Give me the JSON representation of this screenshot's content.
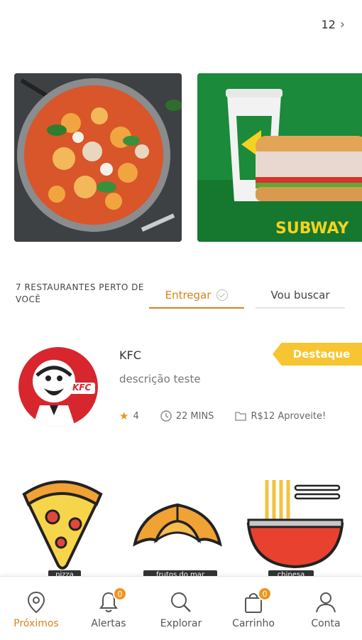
{
  "header": {
    "count": "12"
  },
  "banners": [
    {
      "name": "pasta-banner"
    },
    {
      "name": "subway-banner",
      "brand": "SUBWAY"
    }
  ],
  "section": {
    "nearby_text": "7 RESTAURANTES PERTO DE VOCÊ",
    "tabs": [
      {
        "label": "Entregar",
        "active": true
      },
      {
        "label": "Vou buscar",
        "active": false
      }
    ]
  },
  "restaurant": {
    "name": "KFC",
    "description": "descrição teste",
    "badge": "Destaque",
    "rating": "4",
    "time": "22 MINS",
    "offer": "R$12 Aproveite!",
    "logo_text": "KFC"
  },
  "categories": [
    {
      "label": "pizza",
      "icon": "pizza-icon"
    },
    {
      "label": "frutos do mar",
      "icon": "croissant-icon"
    },
    {
      "label": "chinesa",
      "icon": "noodles-icon"
    }
  ],
  "nav": [
    {
      "label": "Próximos",
      "icon": "location-pin-icon",
      "active": true
    },
    {
      "label": "Alertas",
      "icon": "bell-icon",
      "badge": "0"
    },
    {
      "label": "Explorar",
      "icon": "search-icon"
    },
    {
      "label": "Carrinho",
      "icon": "shopping-bag-icon",
      "badge": "0"
    },
    {
      "label": "Conta",
      "icon": "user-icon"
    }
  ],
  "colors": {
    "accent": "#d9821f",
    "badge": "#f7c531",
    "subway_green": "#1b8a3a"
  }
}
